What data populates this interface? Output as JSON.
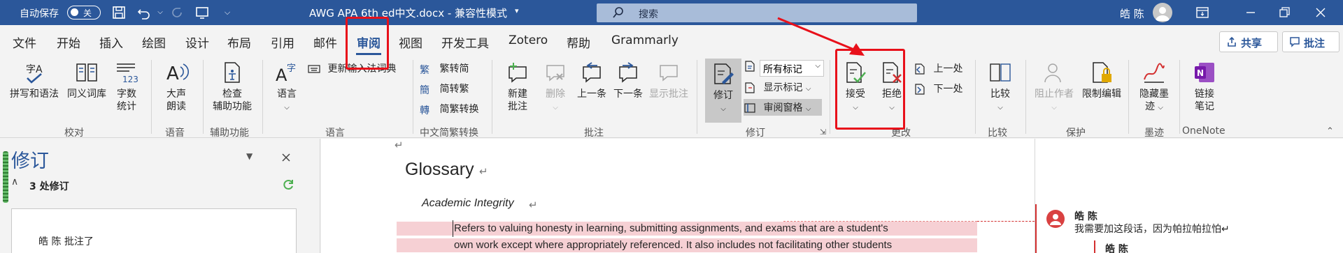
{
  "titlebar": {
    "autosave_label": "自动保存",
    "autosave_state": "关",
    "doc_title": "AWG APA 6th ed中文.docx  -  兼容性模式",
    "search_placeholder": "搜索",
    "user_name": "皓 陈"
  },
  "tabs": [
    "文件",
    "开始",
    "插入",
    "绘图",
    "设计",
    "布局",
    "引用",
    "邮件",
    "审阅",
    "视图",
    "开发工具",
    "Zotero",
    "帮助",
    "Grammarly"
  ],
  "active_tab": "审阅",
  "actions": {
    "share": "共享",
    "comment": "批注"
  },
  "ribbon": {
    "proofing": {
      "spelling": "拼写和语法",
      "thesaurus": "同义词库",
      "wordcount_line1": "字数",
      "wordcount_line2": "统计",
      "label": "校对"
    },
    "speech": {
      "read_aloud_line1": "大声",
      "read_aloud_line2": "朗读",
      "label": "语音"
    },
    "accessibility": {
      "check_line1": "检查",
      "check_line2": "辅助功能",
      "label": "辅助功能"
    },
    "language": {
      "language_btn": "语言",
      "update_ime": "更新输入法词典",
      "label": "语言"
    },
    "chinese_conversion": {
      "to_trad": "繁转简",
      "to_simp": "简转繁",
      "convert": "简繁转换",
      "label": "中文简繁转换"
    },
    "comments": {
      "new_line1": "新建",
      "new_line2": "批注",
      "delete": "删除",
      "prev": "上一条",
      "next": "下一条",
      "show": "显示批注",
      "label": "批注"
    },
    "tracking": {
      "track": "修订",
      "markup_select": "所有标记",
      "show_markup": "显示标记",
      "review_pane": "审阅窗格",
      "label": "修订"
    },
    "changes": {
      "accept": "接受",
      "reject": "拒绝",
      "prev": "上一处",
      "next": "下一处",
      "label": "更改"
    },
    "compare": {
      "compare": "比较",
      "label": "比较"
    },
    "protect": {
      "block_authors": "阻止作者",
      "restrict": "限制编辑",
      "label": "保护"
    },
    "ink": {
      "hide_line1": "隐藏墨",
      "hide_line2": "迹",
      "label": "墨迹"
    },
    "onenote": {
      "link_line1": "链接",
      "link_line2": "笔记",
      "label": "OneNote"
    }
  },
  "revisions_pane": {
    "title": "修订",
    "count": "3 处修订",
    "card_text": "皓 陈 批注了"
  },
  "document": {
    "heading": "Glossary",
    "subheading": "Academic Integrity",
    "line1": "Refers to valuing honesty in learning, submitting assignments, and exams that are a student's",
    "line2": "own work except where appropriately referenced. It also includes not facilitating other students",
    "para_mark": "↵"
  },
  "comments": [
    {
      "author": "皓 陈",
      "text": "我需要加这段话，因为帕拉帕拉怕↵"
    },
    {
      "author": "皓 陈",
      "text": ""
    }
  ],
  "colors": {
    "accent": "#2b579a",
    "highlight": "#e8101a",
    "insert_bg": "#f6d0d4"
  }
}
